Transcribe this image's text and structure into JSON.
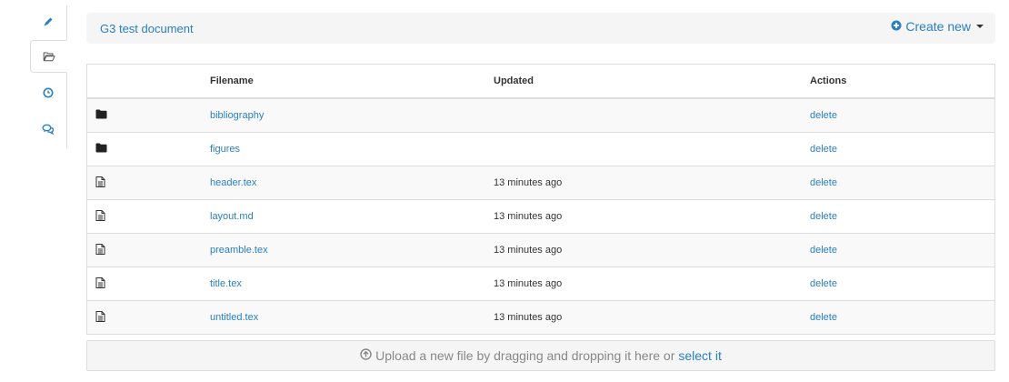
{
  "sidebar": {
    "tabs": [
      {
        "icon": "pencil-icon",
        "name": "edit"
      },
      {
        "icon": "folder-open-icon",
        "name": "files",
        "active": true
      },
      {
        "icon": "clock-icon",
        "name": "history"
      },
      {
        "icon": "comments-icon",
        "name": "comments"
      }
    ]
  },
  "header": {
    "document_title": "G3 test document",
    "create_new_label": "Create new"
  },
  "table": {
    "columns": [
      "",
      "Filename",
      "Updated",
      "Actions"
    ],
    "rows": [
      {
        "type": "folder",
        "name": "bibliography",
        "updated": "",
        "action": "delete"
      },
      {
        "type": "folder",
        "name": "figures",
        "updated": "",
        "action": "delete"
      },
      {
        "type": "file",
        "name": "header.tex",
        "updated": "13 minutes ago",
        "action": "delete"
      },
      {
        "type": "file",
        "name": "layout.md",
        "updated": "13 minutes ago",
        "action": "delete"
      },
      {
        "type": "file",
        "name": "preamble.tex",
        "updated": "13 minutes ago",
        "action": "delete"
      },
      {
        "type": "file",
        "name": "title.tex",
        "updated": "13 minutes ago",
        "action": "delete"
      },
      {
        "type": "file",
        "name": "untitled.tex",
        "updated": "13 minutes ago",
        "action": "delete"
      }
    ]
  },
  "upload": {
    "text": "Upload a new file by dragging and dropping it here or",
    "link_label": "select it"
  },
  "colors": {
    "link": "#2a7fc1",
    "border": "#dddddd",
    "header_bg": "#f5f5f5"
  }
}
